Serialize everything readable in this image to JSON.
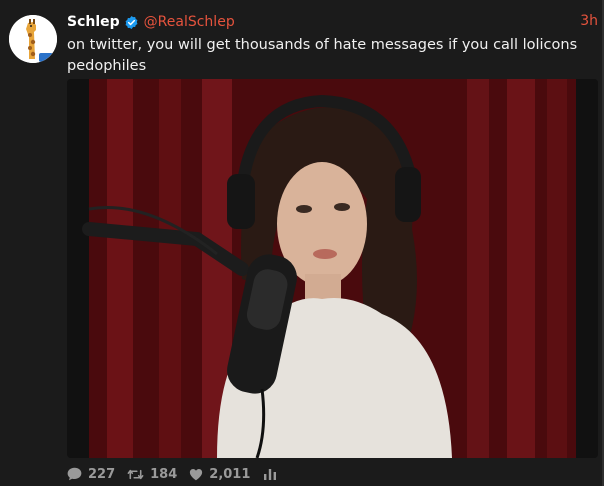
{
  "tweet": {
    "author_name": "Schlep",
    "handle": "@RealSchlep",
    "time": "3h",
    "text": "on twitter, you will get thousands of hate messages if you call lolicons pedophiles",
    "verified": true
  },
  "stats": {
    "replies": "227",
    "retweets": "184",
    "likes": "2,011"
  },
  "icons": {
    "reply": "comment-bubble-icon",
    "retweet": "retweet-icon",
    "like": "heart-icon",
    "analytics": "bar-chart-icon",
    "verified": "verified-badge-icon"
  },
  "colors": {
    "background": "#1b1b1b",
    "accent": "#e5533d",
    "verified": "#1d9bf0",
    "stat_text": "#9a9a9a",
    "curtain": "#5a0d10"
  }
}
